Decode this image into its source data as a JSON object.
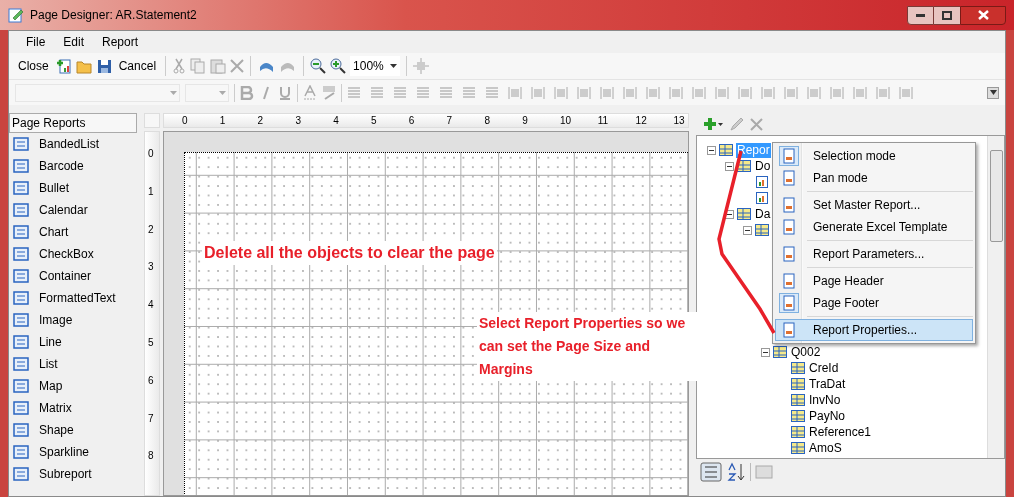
{
  "window": {
    "title": "Page Designer: AR.Statement2"
  },
  "menu": [
    "File",
    "Edit",
    "Report"
  ],
  "toolbar": {
    "close": "Close",
    "cancel": "Cancel",
    "zoom": "100%"
  },
  "toolbox": {
    "title": "Page Reports",
    "items": [
      {
        "label": "BandedList"
      },
      {
        "label": "Barcode"
      },
      {
        "label": "Bullet"
      },
      {
        "label": "Calendar"
      },
      {
        "label": "Chart"
      },
      {
        "label": "CheckBox"
      },
      {
        "label": "Container"
      },
      {
        "label": "FormattedText"
      },
      {
        "label": "Image"
      },
      {
        "label": "Line"
      },
      {
        "label": "List"
      },
      {
        "label": "Map"
      },
      {
        "label": "Matrix"
      },
      {
        "label": "Shape"
      },
      {
        "label": "Sparkline"
      },
      {
        "label": "Subreport"
      }
    ]
  },
  "ruler": {
    "horizontal": [
      "0",
      "1",
      "2",
      "3",
      "4",
      "5",
      "6",
      "7",
      "8",
      "9",
      "10",
      "11",
      "12",
      "13"
    ],
    "vertical": [
      "0",
      "1",
      "2",
      "3",
      "4",
      "5",
      "6",
      "7",
      "8"
    ]
  },
  "annotations": [
    "Delete all the objects to clear the page",
    "Select Report Properties so we can set the Page Size and Margins"
  ],
  "tree": {
    "label": "Repor",
    "selected": true,
    "expanded": true,
    "children": [
      {
        "label": "Do",
        "selected": false,
        "expanded": true,
        "children": [
          {
            "kind": "report"
          },
          {
            "kind": "report"
          }
        ]
      },
      {
        "label": "Da",
        "selected": false,
        "expanded": true,
        "children": [
          {
            "expanded": true,
            "children": [
              {
                "label": "Q002",
                "selected": false,
                "expanded": true,
                "children": [
                  {
                    "label": "CreId",
                    "selected": false
                  },
                  {
                    "label": "TraDat",
                    "selected": false
                  },
                  {
                    "label": "InvNo",
                    "selected": false
                  },
                  {
                    "label": "PayNo",
                    "selected": false
                  },
                  {
                    "label": "Reference1",
                    "selected": false
                  },
                  {
                    "label": "AmoS",
                    "selected": false
                  }
                ]
              }
            ]
          }
        ]
      }
    ]
  },
  "context_menu": [
    [
      {
        "label": "Selection mode",
        "checked": true,
        "selected": false
      },
      {
        "label": "Pan mode",
        "checked": false,
        "selected": false
      }
    ],
    [
      {
        "label": "Set Master Report...",
        "checked": false,
        "selected": false
      },
      {
        "label": "Generate Excel Template",
        "checked": false,
        "selected": false
      }
    ],
    [
      {
        "label": "Report Parameters...",
        "checked": false,
        "selected": false
      }
    ],
    [
      {
        "label": "Page Header",
        "checked": false,
        "selected": false
      },
      {
        "label": "Page Footer",
        "checked": true,
        "selected": false
      }
    ],
    [
      {
        "label": "Report Properties...",
        "checked": false,
        "selected": true
      }
    ]
  ]
}
